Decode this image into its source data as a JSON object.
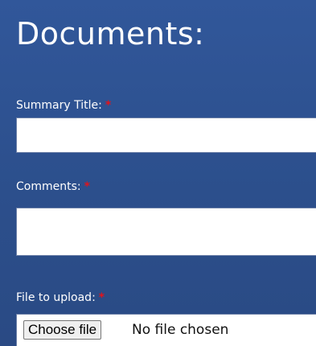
{
  "page": {
    "title": "Documents:"
  },
  "form": {
    "summary_title": {
      "label": "Summary Title:",
      "required_marker": "*",
      "value": ""
    },
    "comments": {
      "label": "Comments:",
      "required_marker": "*",
      "value": ""
    },
    "file_upload": {
      "label": "File to upload:",
      "required_marker": "*",
      "button_label": "Choose file",
      "status_text": "No file chosen"
    }
  },
  "colors": {
    "background": "#2d4f87",
    "text": "#ffffff",
    "required": "#e0141c",
    "field_background": "#ffffff"
  }
}
